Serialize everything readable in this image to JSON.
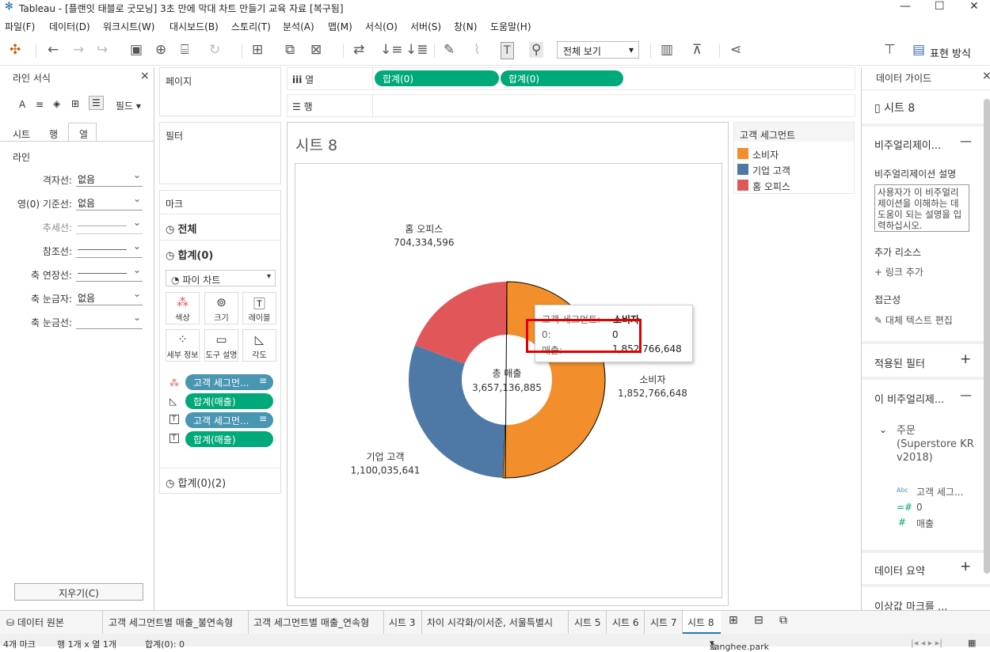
{
  "window": {
    "title": "Tableau - [플랜잇 태블로 굿모닝] 3초 만에 막대 차트 만들기 교육 자료 [복구됨]"
  },
  "menu": [
    "파일(F)",
    "데이터(D)",
    "워크시트(W)",
    "대시보드(B)",
    "스토리(T)",
    "분석(A)",
    "맵(M)",
    "서식(O)",
    "서버(S)",
    "창(N)",
    "도움말(H)"
  ],
  "toolbar": {
    "view_select": "전체 보기",
    "show_me": "표현 방식"
  },
  "left_pane": {
    "title": "라인 서식",
    "fields_label": "필드",
    "tabs": [
      "시트",
      "행",
      "열"
    ],
    "section": "라인",
    "rows": [
      {
        "label": "격자선:",
        "value": "없음"
      },
      {
        "label": "영(0) 기준선:",
        "value": "없음"
      },
      {
        "label": "추세선:",
        "value": ""
      },
      {
        "label": "참조선:",
        "value": ""
      },
      {
        "label": "축 연장선:",
        "value": ""
      },
      {
        "label": "축 눈금자:",
        "value": "없음"
      },
      {
        "label": "축 눈금선:",
        "value": ""
      }
    ],
    "clear_button": "지우기(C)"
  },
  "shelves": {
    "pages": "페이지",
    "filters": "필터",
    "marks": "마크",
    "columns_label": "열",
    "rows_label": "행",
    "column_pills": [
      "합계(0)",
      "합계(0)"
    ]
  },
  "marks": {
    "all": "전체",
    "current": "합계(0)",
    "mark_type": "파이 차트",
    "buttons": [
      "색상",
      "크기",
      "레이블",
      "세부 정보",
      "도구 설명",
      "각도"
    ],
    "fields": [
      "고객 세그먼...",
      "합계(매출)",
      "고객 세그먼...",
      "합계(매출)"
    ],
    "second": "합계(0)(2)"
  },
  "sheet": {
    "title": "시트 8"
  },
  "legend": {
    "title": "고객 세그먼트",
    "items": [
      {
        "label": "소비자",
        "color": "#f28e2b"
      },
      {
        "label": "기업 고객",
        "color": "#4e79a7"
      },
      {
        "label": "홈 오피스",
        "color": "#e15759"
      }
    ]
  },
  "chart_data": {
    "type": "pie",
    "categories": [
      "소비자",
      "기업 고객",
      "홈 오피스"
    ],
    "values": [
      1852766648,
      1100035641,
      704334596
    ],
    "value_labels": [
      "1,852,766,648",
      "1,100,035,641",
      "704,334,596"
    ],
    "colors": [
      "#f28e2b",
      "#4e79a7",
      "#e15759"
    ],
    "center_label": "총 매출",
    "center_value": "3,657,136,885"
  },
  "tooltip": {
    "seg_label": "고객 세그먼트:",
    "seg_value": "소비자",
    "zero_label": "0:",
    "zero_value": "0",
    "sales_label": "매출:",
    "sales_value": "1,852,766,648"
  },
  "right_pane": {
    "title": "데이터 가이드",
    "sheet": "시트 8",
    "viz_section": "비주얼리제이...",
    "viz_desc_label": "비주얼리제이션 설명",
    "viz_desc_placeholder": "사용자가 이 비주얼리제이션을 이해하는 데 도움이 되는 설명을 입력하십시오.",
    "resources_label": "추가 리소스",
    "add_link": "링크 추가",
    "accessibility": "접근성",
    "alt_text": "대체 텍스트 편집",
    "applied_filters": "적용된 필터",
    "this_viz": "이 비주얼리제...",
    "datasource": "주문 (Superstore KR v2018)",
    "fields": [
      "고객 세그...",
      "0",
      "매출"
    ],
    "data_summary": "데이터 요약",
    "outliers": "이상값 마크를 ..."
  },
  "bottom_tabs": [
    "데이터 원본",
    "고객 세그먼트별 매출_불연속형",
    "고객 세그먼트별 매출_연속형",
    "시트 3",
    "차이 시각화/이서준, 서울특별시",
    "시트 5",
    "시트 6",
    "시트 7",
    "시트 8"
  ],
  "status": {
    "marks": "4개 마크",
    "rows_cols": "행 1개 x 열 1개",
    "sum": "합계(0): 0",
    "user": "sanghee.park"
  }
}
